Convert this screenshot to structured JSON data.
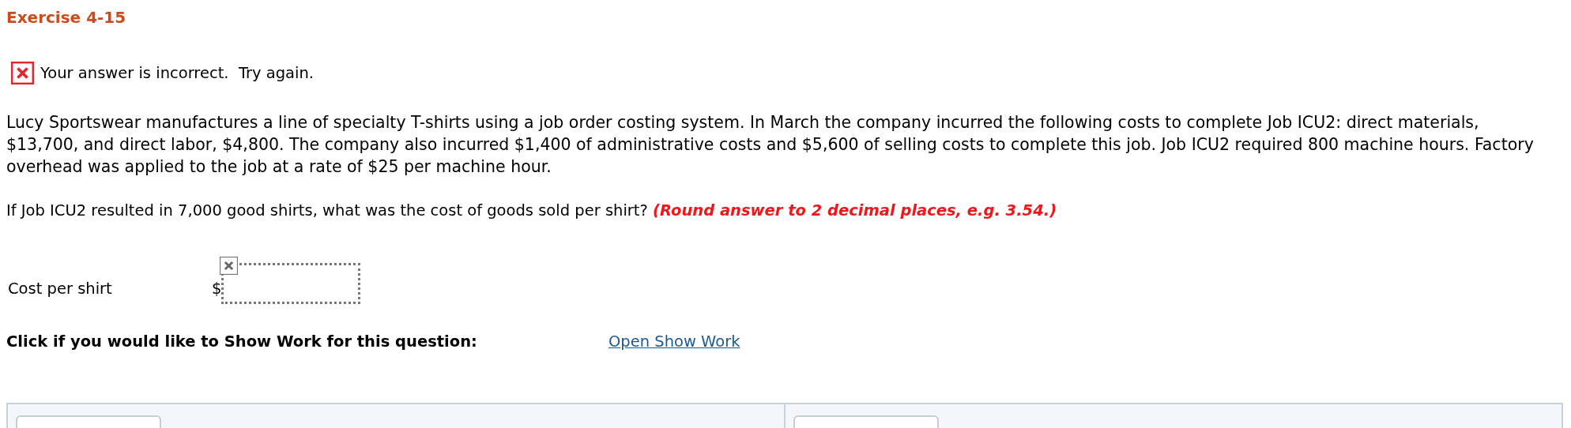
{
  "title": "Exercise 4-15",
  "feedback": {
    "correct": false,
    "text": "Your answer is incorrect.  Try again."
  },
  "problem": "Lucy Sportswear manufactures a line of specialty T-shirts using a job order costing system. In March the company incurred the following costs to complete Job ICU2: direct materials, $13,700, and direct labor, $4,800. The company also incurred $1,400 of administrative costs and $5,600 of selling costs to complete this job. Job ICU2 required 800 machine hours. Factory overhead was applied to the job at a rate of $25 per machine hour.",
  "question": "If Job ICU2 resulted in 7,000 good shirts, what was the cost of goods sold per shirt? *(Round answer to 2 decimal places, e.g. 3.54.)*",
  "answer": {
    "label": "Cost per shirt",
    "unit": "$"
  },
  "show_work": {
    "prompt": "Click if you would like to Show Work for this question:",
    "link": "Open Show Work"
  }
}
